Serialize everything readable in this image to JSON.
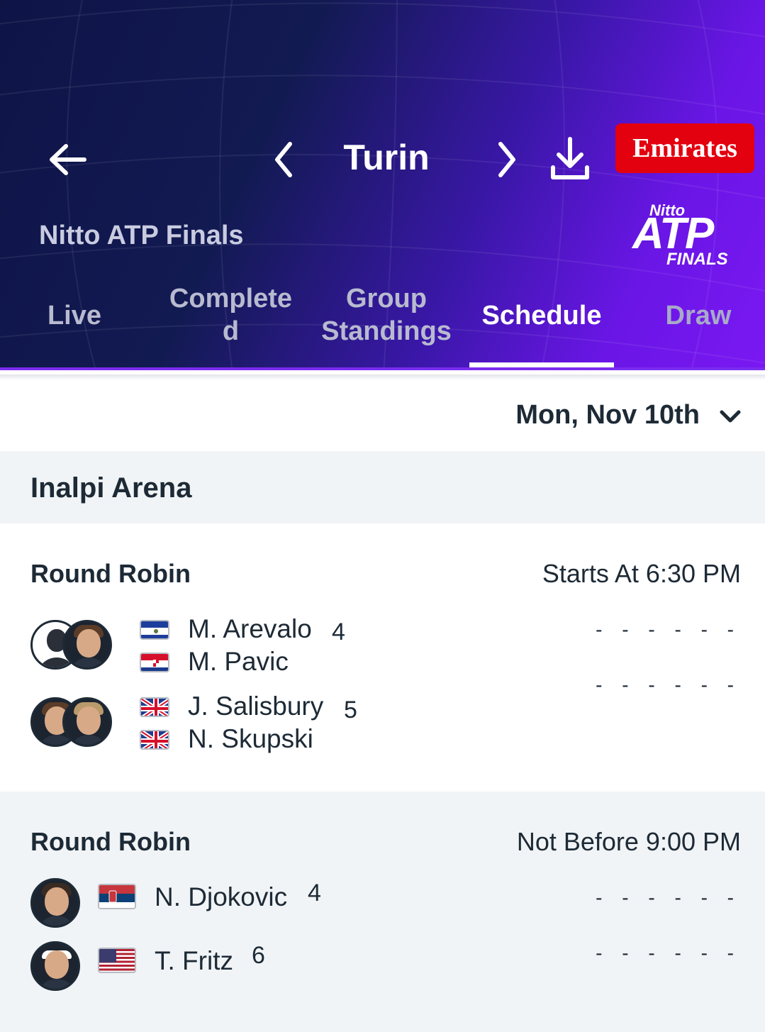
{
  "header": {
    "title": "Turin",
    "sponsor": "Emirates",
    "tournament_name": "Nitto ATP Finals",
    "logo": {
      "top": "Nitto",
      "middle": "ATP",
      "bottom": "FINALS"
    },
    "tabs": [
      {
        "label_line1": "Live",
        "label_line2": ""
      },
      {
        "label_line1": "Complete",
        "label_line2": "d"
      },
      {
        "label_line1": "Group",
        "label_line2": "Standings"
      },
      {
        "label_line1": "Schedule",
        "label_line2": ""
      },
      {
        "label_line1": "Draw",
        "label_line2": ""
      }
    ],
    "active_tab": "Schedule"
  },
  "date_selector": {
    "label": "Mon, Nov 10th"
  },
  "venue": {
    "name": "Inalpi Arena"
  },
  "matches": [
    {
      "round": "Round Robin",
      "time": "Starts At 6:30 PM",
      "teams": [
        {
          "seed": "4",
          "players": [
            {
              "name": "M. Arevalo",
              "flag": "ESA"
            },
            {
              "name": "M. Pavic",
              "flag": "CRO"
            }
          ],
          "score": "- - - - - -"
        },
        {
          "seed": "5",
          "players": [
            {
              "name": "J. Salisbury",
              "flag": "GBR"
            },
            {
              "name": "N. Skupski",
              "flag": "GBR"
            }
          ],
          "score": "- - - - - -"
        }
      ]
    },
    {
      "round": "Round Robin",
      "time": "Not Before 9:00 PM",
      "teams": [
        {
          "seed": "4",
          "players": [
            {
              "name": "N. Djokovic",
              "flag": "SRB"
            }
          ],
          "score": "- - - - - -"
        },
        {
          "seed": "6",
          "players": [
            {
              "name": "T. Fritz",
              "flag": "USA"
            }
          ],
          "score": "- - - - - -"
        }
      ]
    }
  ],
  "icons": [
    "arrow-left-icon",
    "chevron-left-icon",
    "chevron-right-icon",
    "download-icon",
    "chevron-down-icon"
  ],
  "colors": {
    "accent": "#7b2cf0",
    "sponsor_red": "#e3000f",
    "header_dark": "#121a52",
    "text": "#1d2a36"
  }
}
